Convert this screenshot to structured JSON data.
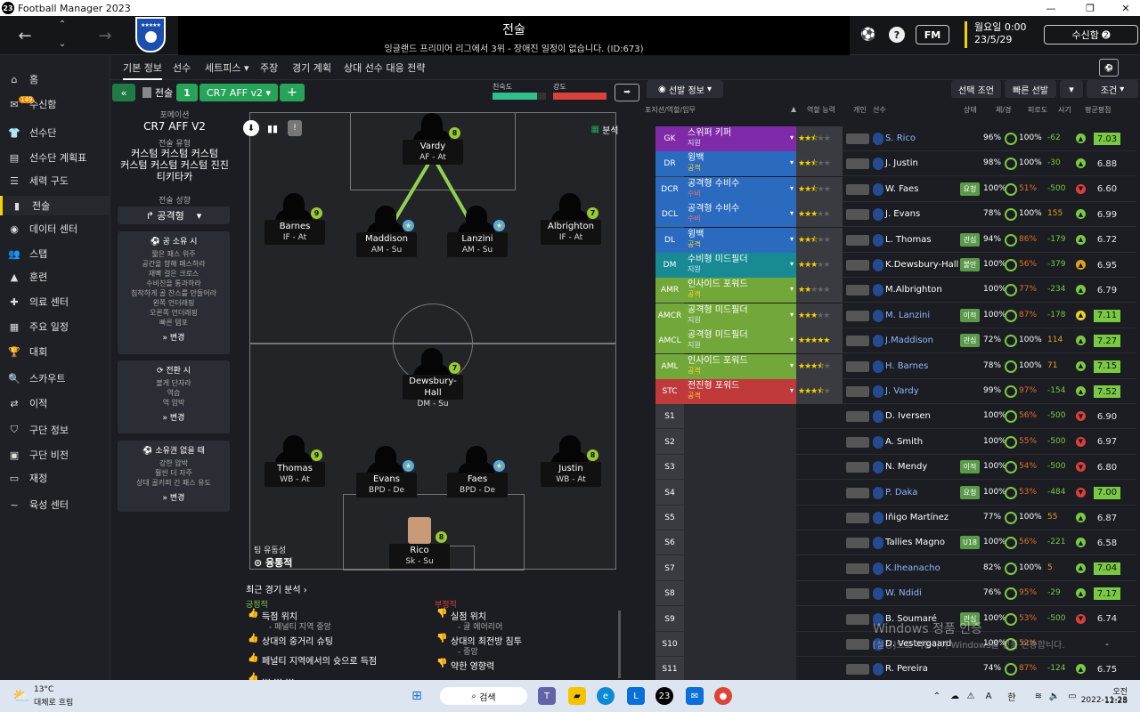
{
  "window": {
    "title": "Football Manager 2023",
    "logo": "23"
  },
  "header": {
    "title": "전술",
    "subtitle": "잉글랜드 프리미어 리그에서 3위 - 장애진 일정이 없습니다. (ID:673)",
    "fm_label": "FM",
    "date_line1": "월요일 0:00",
    "date_line2": "23/5/29",
    "inbox_label": "수신함 ➋"
  },
  "sidebar": {
    "items": [
      {
        "icon": "home-icon",
        "glyph": "⌂",
        "label": "홈"
      },
      {
        "icon": "inbox-icon",
        "glyph": "✉",
        "label": "수신함",
        "badge": "149"
      },
      {
        "icon": "shirt-icon",
        "glyph": "👕",
        "label": "선수단"
      },
      {
        "icon": "clipboard-icon",
        "glyph": "▤",
        "label": "선수단 계획표"
      },
      {
        "icon": "depth-icon",
        "glyph": "☰",
        "label": "세력 구도"
      },
      {
        "icon": "tactics-icon",
        "glyph": "▮",
        "label": "전술"
      },
      {
        "icon": "data-icon",
        "glyph": "◉",
        "label": "데이터 센터"
      },
      {
        "icon": "staff-icon",
        "glyph": "👥",
        "label": "스탭"
      },
      {
        "icon": "training-icon",
        "glyph": "▲",
        "label": "훈련"
      },
      {
        "icon": "medical-icon",
        "glyph": "✚",
        "label": "의료 센터"
      },
      {
        "icon": "calendar-icon",
        "glyph": "▦",
        "label": "주요 일정"
      },
      {
        "icon": "trophy-icon",
        "glyph": "🏆",
        "label": "대회"
      },
      {
        "icon": "scout-icon",
        "glyph": "🔍",
        "label": "스카우트"
      },
      {
        "icon": "transfer-icon",
        "glyph": "⇄",
        "label": "이적"
      },
      {
        "icon": "club-icon",
        "glyph": "⛉",
        "label": "구단 정보"
      },
      {
        "icon": "vision-icon",
        "glyph": "▣",
        "label": "구단 비전"
      },
      {
        "icon": "finance-icon",
        "glyph": "▭",
        "label": "재정"
      },
      {
        "icon": "development-icon",
        "glyph": "~",
        "label": "육성 센터"
      }
    ]
  },
  "topnav": {
    "tabs": [
      "기본 정보",
      "선수",
      "세트피스 ▾",
      "주장",
      "경기 계획",
      "상대 선수 대응 전략"
    ]
  },
  "tactic_bar": {
    "tactic_label": "전술",
    "slot": "1",
    "tactic_name": "CR7 AFF v2",
    "familiarity_label": "친숙도",
    "strength_label": "강도"
  },
  "left_panel": {
    "formation_label": "포메이션",
    "formation_value": "CR7 AFF V2",
    "style_label": "전술 유형",
    "style_value": [
      "커스텀 커스텀 커스텀",
      "커스텀 커스텀 커스텀 진진",
      "티키타카"
    ],
    "mentality_label": "전술 성향",
    "mentality_value": "공격형",
    "in_possession_title": "공 소유 시",
    "in_possession_lines": [
      "짧은 패스 위주",
      "공간을 향해 패스하라",
      "재빡 걸은 크로스",
      "수비진을 통과하라",
      "침착하게 골 찬스를 만들어라",
      "왼쪽 언더래핑",
      "오른쪽 언더래핑",
      "빠른 템포"
    ],
    "in_transition_title": "전환 시",
    "in_transition_lines": [
      "볼게 단자라",
      "역습",
      "역 압박"
    ],
    "out_possession_title": "소유권 없을 때",
    "out_possession_lines": [
      "강한 압박",
      "훨씬 더 자주",
      "상대 골키퍼 긴 패스 유도"
    ],
    "change_label": "» 변경"
  },
  "pitch": {
    "analysis_label": "분석",
    "team_fluidity_label": "팀 유동성",
    "team_fluidity_value": "융통적",
    "players": [
      {
        "name": "Vardy",
        "role": "AF - At",
        "rating": "8"
      },
      {
        "name": "Barnes",
        "role": "IF - At",
        "rating": "9"
      },
      {
        "name": "Maddison",
        "role": "AM - Su",
        "rating": "★"
      },
      {
        "name": "Lanzini",
        "role": "AM - Su",
        "rating": "★"
      },
      {
        "name": "Albrighton",
        "role": "IF - At",
        "rating": "7"
      },
      {
        "name": "Dewsbury-Hall",
        "role": "DM - Su",
        "rating": "7"
      },
      {
        "name": "Thomas",
        "role": "WB - At",
        "rating": "9"
      },
      {
        "name": "Evans",
        "role": "BPD - De",
        "rating": "★"
      },
      {
        "name": "Faes",
        "role": "BPD - De",
        "rating": "★"
      },
      {
        "name": "Justin",
        "role": "WB - At",
        "rating": "8"
      },
      {
        "name": "Rico",
        "role": "Sk - Su",
        "rating": "8"
      }
    ]
  },
  "analysis": {
    "title": "최근 경기 분석 ›",
    "positive_label": "긍정적",
    "negative_label": "부정적",
    "positive": [
      {
        "title": "득점 위치",
        "sub": "- 페널티 지역 중앙"
      },
      {
        "title": "상대의 중거리 슈팅",
        "sub": ""
      },
      {
        "title": "페널티 지역에서의 슛으로 득점",
        "sub": ""
      },
      {
        "title": "… … …",
        "sub": ""
      }
    ],
    "negative": [
      {
        "title": "실점 위치",
        "sub": "- 골 에어리어"
      },
      {
        "title": "상대의 최전방 침투",
        "sub": "- 중앙"
      },
      {
        "title": "약한 영향력",
        "sub": ""
      }
    ]
  },
  "right_panel": {
    "selection_info": "선발 정보",
    "btn_select": "선택 조언",
    "btn_quick": "빠른 선발",
    "btn_filter": "조건",
    "col_pos": "포지션/역할/임무",
    "col_role_ability": "역할 능력",
    "col_personal": "개인",
    "col_player": "선수",
    "col_condition": "상태",
    "col_fitness": "체/경",
    "col_fatigue": "피로도",
    "col_rotation": "시기",
    "col_rating": "평균평점",
    "rows": [
      {
        "pos": "GK",
        "role": "스위퍼 키퍼",
        "duty": "지원",
        "color": "#7f2aa8",
        "stars": 2.5,
        "name": "S. Rico",
        "tag": "",
        "cond": "96%",
        "fit": "100%",
        "fatigue": "-62",
        "status": "g",
        "rating": "7.03",
        "hl": true
      },
      {
        "pos": "DR",
        "role": "윙백",
        "duty": "공격",
        "color": "#2a6bbf",
        "stars": 2.5,
        "name": "J. Justin",
        "tag": "",
        "cond": "98%",
        "fit": "100%",
        "fatigue": "-30",
        "status": "g",
        "rating": "6.88",
        "hl": false
      },
      {
        "pos": "DCR",
        "role": "공격형 수비수",
        "duty": "수비",
        "color": "#2a6bbf",
        "stars": 2.5,
        "name": "W. Faes",
        "tag": "요청",
        "cond": "100%",
        "fit": "51%",
        "fatigue": "-500",
        "status": "r",
        "rating": "6.60",
        "hl": false
      },
      {
        "pos": "DCL",
        "role": "공격형 수비수",
        "duty": "수비",
        "color": "#2a6bbf",
        "stars": 3,
        "name": "J. Evans",
        "tag": "",
        "cond": "78%",
        "fit": "100%",
        "fatigue": "155",
        "status": "g",
        "rating": "6.99",
        "hl": false
      },
      {
        "pos": "DL",
        "role": "윙백",
        "duty": "공격",
        "color": "#2a6bbf",
        "stars": 2.5,
        "name": "L. Thomas",
        "tag": "관심",
        "cond": "94%",
        "fit": "86%",
        "fatigue": "-179",
        "status": "g",
        "rating": "6.72",
        "hl": false
      },
      {
        "pos": "DM",
        "role": "수비형 미드필더",
        "duty": "지원",
        "color": "#178a93",
        "stars": 3,
        "name": "K.Dewsbury-Hall",
        "tag": "불만",
        "cond": "100%",
        "fit": "56%",
        "fatigue": "-379",
        "status": "o",
        "rating": "6.95",
        "hl": false
      },
      {
        "pos": "AMR",
        "role": "인사이드 포워드",
        "duty": "공격",
        "color": "#72a83a",
        "stars": 2,
        "name": "M.Albrighton",
        "tag": "",
        "cond": "100%",
        "fit": "77%",
        "fatigue": "-234",
        "status": "g",
        "rating": "6.79",
        "hl": false
      },
      {
        "pos": "AMCR",
        "role": "공격형 미드필더",
        "duty": "지원",
        "color": "#72a83a",
        "stars": 3,
        "name": "M. Lanzini",
        "tag": "이적",
        "cond": "100%",
        "fit": "87%",
        "fatigue": "-178",
        "status": "y",
        "rating": "7.11",
        "hl": true
      },
      {
        "pos": "AMCL",
        "role": "공격형 미드필더",
        "duty": "지원",
        "color": "#72a83a",
        "stars": 5,
        "name": "J.Maddison",
        "tag": "관심",
        "cond": "72%",
        "fit": "100%",
        "fatigue": "114",
        "status": "g",
        "rating": "7.27",
        "hl": true
      },
      {
        "pos": "AML",
        "role": "인사이드 포워드",
        "duty": "공격",
        "color": "#72a83a",
        "stars": 3.5,
        "name": "H. Barnes",
        "tag": "",
        "cond": "78%",
        "fit": "100%",
        "fatigue": "71",
        "status": "g",
        "rating": "7.15",
        "hl": true
      },
      {
        "pos": "STC",
        "role": "전진형 포워드",
        "duty": "공격",
        "color": "#c0393b",
        "stars": 3.5,
        "name": "J. Vardy",
        "tag": "",
        "cond": "99%",
        "fit": "97%",
        "fatigue": "-154",
        "status": "g",
        "rating": "7.52",
        "hl": true
      },
      {
        "pos": "S1",
        "name": "D. Iversen",
        "tag": "",
        "cond": "100%",
        "fit": "56%",
        "fatigue": "-500",
        "status": "r",
        "rating": "6.90",
        "hl": false
      },
      {
        "pos": "S2",
        "name": "A. Smith",
        "tag": "",
        "cond": "100%",
        "fit": "55%",
        "fatigue": "-500",
        "status": "r",
        "rating": "6.97",
        "hl": false
      },
      {
        "pos": "S3",
        "name": "N. Mendy",
        "tag": "이적",
        "cond": "100%",
        "fit": "54%",
        "fatigue": "-500",
        "status": "r",
        "rating": "6.80",
        "hl": false
      },
      {
        "pos": "S4",
        "name": "P. Daka",
        "tag": "요청",
        "cond": "100%",
        "fit": "53%",
        "fatigue": "-484",
        "status": "r",
        "rating": "7.00",
        "hl": true
      },
      {
        "pos": "S5",
        "name": "Iñigo Martínez",
        "tag": "",
        "cond": "77%",
        "fit": "100%",
        "fatigue": "55",
        "status": "g",
        "rating": "6.87",
        "hl": false
      },
      {
        "pos": "S6",
        "name": "Tallies Magno",
        "tag": "U18",
        "cond": "100%",
        "fit": "56%",
        "fatigue": "-221",
        "status": "g",
        "rating": "6.58",
        "hl": false
      },
      {
        "pos": "S7",
        "name": "K.Iheanacho",
        "tag": "",
        "cond": "82%",
        "fit": "100%",
        "fatigue": "5",
        "status": "g",
        "rating": "7.04",
        "hl": true
      },
      {
        "pos": "S8",
        "name": "W. Ndidi",
        "tag": "",
        "cond": "76%",
        "fit": "95%",
        "fatigue": "-29",
        "status": "g",
        "rating": "7.17",
        "hl": true
      },
      {
        "pos": "S9",
        "name": "B. Soumaré",
        "tag": "관심",
        "cond": "100%",
        "fit": "53%",
        "fatigue": "-500",
        "status": "r",
        "rating": "6.74",
        "hl": false
      },
      {
        "pos": "S10",
        "name": "D. Vestergaard",
        "tag": "",
        "cond": "100%",
        "fit": "52%",
        "fatigue": "-",
        "status": "",
        "rating": "-",
        "hl": false
      },
      {
        "pos": "S11",
        "name": "R. Pereira",
        "tag": "",
        "cond": "74%",
        "fit": "87%",
        "fatigue": "-124",
        "status": "g",
        "rating": "6.75",
        "hl": false
      }
    ]
  },
  "watermark": {
    "line1": "Windows 정품 인증",
    "line2": "[설정]으로 이동하여 Windows를 정품 인증합니다."
  },
  "taskbar": {
    "temp": "13°C",
    "weather": "대체로 흐림",
    "search": "검색",
    "ime": "한",
    "lang": "A",
    "time": "오전 12:28",
    "date": "2022-11-23"
  },
  "colors": {
    "accent": "#f5d200",
    "positive": "#7ac943",
    "negative": "#d9413a",
    "tab_green": "#27a35a"
  }
}
